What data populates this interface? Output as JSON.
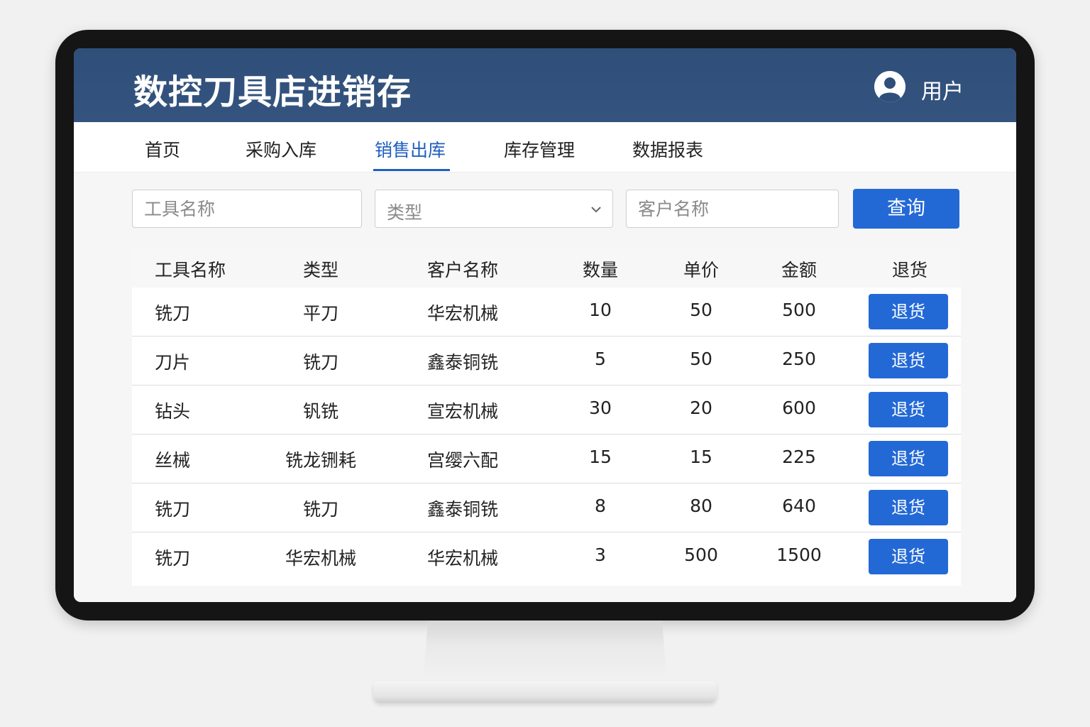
{
  "header": {
    "title": "数控刀具店进销存",
    "user_label": "用户"
  },
  "nav": {
    "items": [
      "首页",
      "采购入库",
      "销售出库",
      "库存管理",
      "数据报表"
    ],
    "active": "销售出库"
  },
  "filters": {
    "tool_name_placeholder": "工具名称",
    "type_select_value": "类型",
    "customer_placeholder": "客户名称",
    "query_label": "查询"
  },
  "table": {
    "headers": [
      "工具名称",
      "类型",
      "客户名称",
      "数量",
      "单价",
      "金额",
      "退货"
    ],
    "rows": [
      {
        "tool": "铣刀",
        "type": "平刀",
        "customer": "华宏机械",
        "qty": "10",
        "price": "50",
        "amount": "500",
        "action": "退货"
      },
      {
        "tool": "刀片",
        "type": "铣刀",
        "customer": "鑫泰铜铣",
        "qty": "5",
        "price": "50",
        "amount": "250",
        "action": "退货"
      },
      {
        "tool": "钻头",
        "type": "钒铣",
        "customer": "宣宏机械",
        "qty": "30",
        "price": "20",
        "amount": "600",
        "action": "退货"
      },
      {
        "tool": "丝械",
        "type": "铣龙铏耗",
        "customer": "宫缨六配",
        "qty": "15",
        "price": "15",
        "amount": "225",
        "action": "退货"
      },
      {
        "tool": "铣刀",
        "type": "铣刀",
        "customer": "鑫泰铜铣",
        "qty": "8",
        "price": "80",
        "amount": "640",
        "action": "退货"
      },
      {
        "tool": "铣刀",
        "type": "华宏机械",
        "customer": "华宏机械",
        "qty": "3",
        "price": "500",
        "amount": "1500",
        "action": "退货"
      }
    ]
  },
  "colors": {
    "header_bg": "#2f4f7a",
    "accent": "#2369d6",
    "active_nav": "#1f5fbf"
  },
  "icons": {
    "avatar": "user-avatar-icon",
    "dropdown": "chevron-down-icon"
  }
}
